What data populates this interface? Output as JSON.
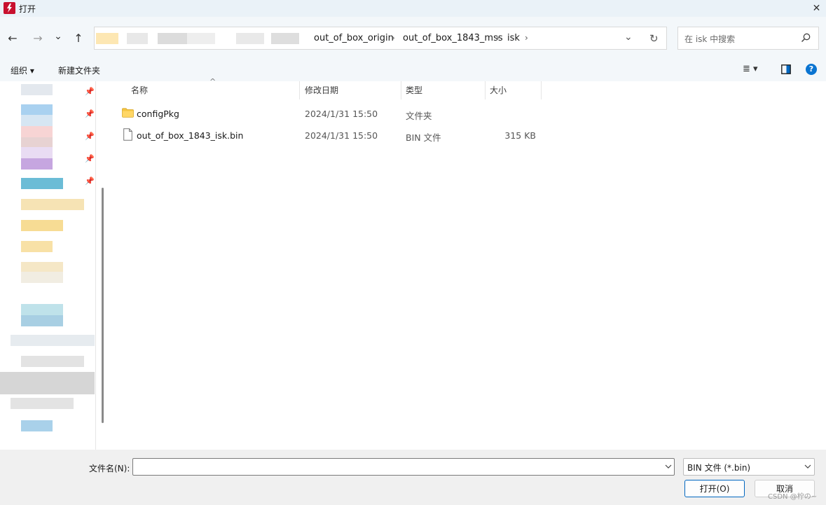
{
  "window": {
    "title": "打开",
    "close_glyph": "✕"
  },
  "nav": {
    "back_icon": "←",
    "forward_icon": "→",
    "recent_icon": "⌄",
    "up_icon": "↑",
    "breadcrumbs": [
      "out_of_box_origin",
      "out_of_box_1843_mss",
      "isk"
    ],
    "separator": "›",
    "dropdown_icon": "⌄",
    "refresh_icon": "↻"
  },
  "search": {
    "placeholder": "在 isk 中搜索"
  },
  "toolbar": {
    "organize": "组织 ▾",
    "new_folder": "新建文件夹",
    "view_icon": "≣ ▾",
    "help_icon": "?"
  },
  "columns": {
    "name": "名称",
    "date": "修改日期",
    "type": "类型",
    "size": "大小",
    "sort_icon": "^"
  },
  "files": [
    {
      "name": "configPkg",
      "date": "2024/1/31 15:50",
      "type": "文件夹",
      "size": "",
      "icon": "folder-icon"
    },
    {
      "name": "out_of_box_1843_isk.bin",
      "date": "2024/1/31 15:50",
      "type": "BIN 文件",
      "size": "315 KB",
      "icon": "file-icon"
    }
  ],
  "footer": {
    "filename_label": "文件名(N):",
    "filename_value": "",
    "filter": "BIN 文件 (*.bin)",
    "open": "打开(O)",
    "cancel": "取消",
    "watermark": "CSDN @柠の~"
  },
  "colors": {
    "accent": "#0067c0",
    "folder": "#f4c542",
    "app_icon": "#c8102e"
  }
}
